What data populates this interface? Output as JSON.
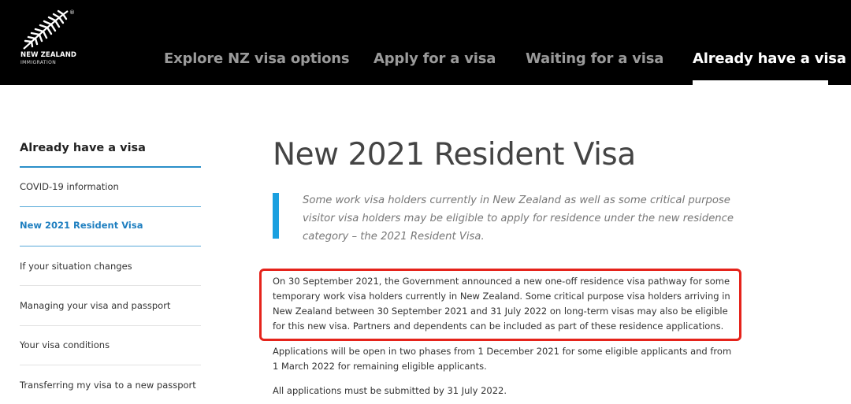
{
  "header": {
    "logo": {
      "brand": "NEW ZEALAND",
      "sub": "IMMIGRATION",
      "reg": "®",
      "icon": "silver-fern-icon"
    },
    "nav": [
      {
        "label": "Explore NZ visa options"
      },
      {
        "label": "Apply for a visa"
      },
      {
        "label": "Waiting for a visa"
      },
      {
        "label": "Already have a visa"
      }
    ]
  },
  "sidebar": {
    "title": "Already have a visa",
    "items": [
      {
        "label": "COVID-19 information"
      },
      {
        "label": "New 2021 Resident Visa"
      },
      {
        "label": "If your situation changes"
      },
      {
        "label": "Managing your visa and passport"
      },
      {
        "label": "Your visa conditions"
      },
      {
        "label": "Transferring my visa to a new passport"
      }
    ]
  },
  "main": {
    "title": "New 2021 Resident Visa",
    "intro": "Some work visa holders currently in New Zealand as well as some critical purpose visitor visa holders may be eligible to apply for residence under the new residence category – the 2021 Resident Visa.",
    "paragraphs": [
      "On 30 September 2021, the Government announced a new one-off residence visa pathway for some temporary work visa holders currently in New Zealand. Some critical purpose visa holders arriving in New Zealand between 30 September 2021 and 31 July 2022 on long-term visas may also be eligible for this new visa. Partners and dependents can be included as part of these residence applications.",
      "Applications will be open in two phases from 1 December 2021 for some eligible applicants and from 1 March 2022 for remaining eligible applicants.",
      "All applications must be submitted by 31 July 2022."
    ]
  },
  "colors": {
    "header_bg": "#000000",
    "accent_blue": "#1aa0e0",
    "active_link": "#1f7fc0",
    "highlight_red": "#e5231b"
  }
}
